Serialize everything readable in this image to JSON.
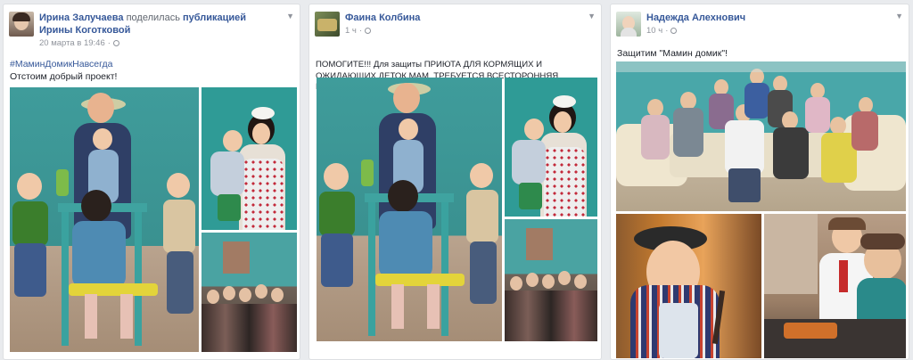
{
  "posts": [
    {
      "author": "Ирина Залучаева",
      "action": "поделилась",
      "shared_link": "публикацией Ирины Коготковой",
      "time": "20 марта в 19:46",
      "hashtag": "#МаминДомикНавсегда",
      "text": "Отстоим добрый проект!"
    },
    {
      "author": "Фаина Колбина",
      "time": "1 ч",
      "text": "ПОМОГИТЕ!!! Для защиты ПРИЮТА ДЛЯ КОРМЯЩИХ И ОЖИДАЮЩИХ ДЕТОК МАМ, ТРЕБУЕТСЯ ВСЕСТОРОННЯЯ ПОМОЩЬ!!! ПОМОГИТЕ!!!"
    },
    {
      "author": "Надежда Алехнович",
      "time": "10 ч",
      "text": "Защитим \"Мамин домик\"!"
    }
  ],
  "icons": {
    "menu": "chevron-down-icon",
    "privacy": "globe-icon"
  },
  "colors": {
    "link": "#365899",
    "teal_wall": "#3c9a98",
    "background": "#e9ebee"
  }
}
